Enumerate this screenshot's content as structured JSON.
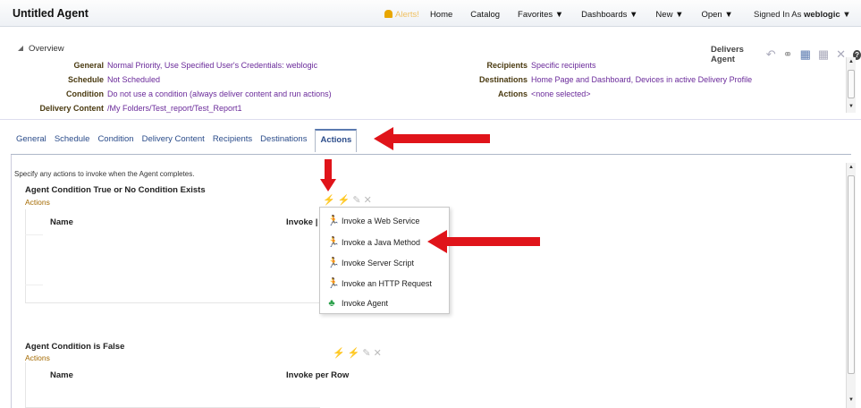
{
  "header": {
    "title": "Untitled Agent",
    "alerts_label": "Alerts!",
    "nav": [
      "Home",
      "Catalog",
      "Favorites ▼",
      "Dashboards ▼",
      "New ▼",
      "Open ▼"
    ],
    "signed_in_prefix": "Signed In As",
    "signed_in_user": "weblogic ▼"
  },
  "overview": {
    "label": "Overview",
    "delivers_label": "Delivers Agent",
    "left": [
      {
        "label": "General",
        "value": "Normal Priority, Use Specified User's Credentials: weblogic"
      },
      {
        "label": "Schedule",
        "value": "Not Scheduled"
      },
      {
        "label": "Condition",
        "value": "Do not use a condition (always deliver content and run actions)"
      },
      {
        "label": "Delivery Content",
        "value": "/My Folders/Test_report/Test_Report1"
      }
    ],
    "right": [
      {
        "label": "Recipients",
        "value": "Specific recipients"
      },
      {
        "label": "Destinations",
        "value": "Home Page and Dashboard, Devices in active Delivery Profile"
      },
      {
        "label": "Actions",
        "value": "<none selected>"
      }
    ]
  },
  "tabs": [
    "General",
    "Schedule",
    "Condition",
    "Delivery Content",
    "Recipients",
    "Destinations"
  ],
  "active_tab": "Actions",
  "actions_panel": {
    "intro": "Specify any actions to invoke when the Agent completes.",
    "section1": {
      "title": "Agent Condition True or No Condition Exists",
      "sub": "Actions",
      "col1": "Name",
      "col2": "Invoke per Row",
      "col2_truncated": "Invoke |"
    },
    "section2": {
      "title": "Agent Condition is False",
      "sub": "Actions",
      "col1": "Name",
      "col2": "Invoke per Row"
    }
  },
  "menu": [
    {
      "label": "Invoke a Web Service",
      "icon": "runner-icon"
    },
    {
      "label": "Invoke a Java Method",
      "icon": "runner-icon"
    },
    {
      "label": "Invoke Server Script",
      "icon": "runner-icon"
    },
    {
      "label": "Invoke an HTTP Request",
      "icon": "runner-icon"
    },
    {
      "label": "Invoke Agent",
      "icon": "agent-icon"
    }
  ],
  "colors": {
    "annotation_arrow": "#e0141a",
    "link": "#6a2a9a",
    "tab": "#2b4c8a"
  }
}
